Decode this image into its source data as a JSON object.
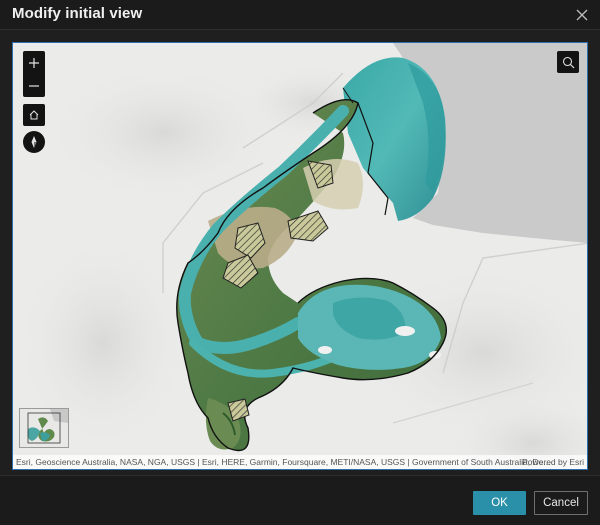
{
  "dialog": {
    "title": "Modify initial view"
  },
  "map": {
    "attribution": "Esri, Geoscience Australia, NASA, NGA, USGS | Esri, HERE, Garmin, Foursquare, METI/NASA, USGS | Government of South Australia, De...",
    "powered_by": "Powered by Esri",
    "controls": {
      "zoom_in_icon": "plus-icon",
      "zoom_out_icon": "minus-icon",
      "home_icon": "home-icon",
      "compass_icon": "compass-icon",
      "search_icon": "search-icon"
    }
  },
  "footer": {
    "ok_label": "OK",
    "cancel_label": "Cancel"
  },
  "colors": {
    "primary_button": "#2a8fa9",
    "map_focus_border": "#2b6fb0",
    "dialog_background": "#1b1b1b"
  }
}
